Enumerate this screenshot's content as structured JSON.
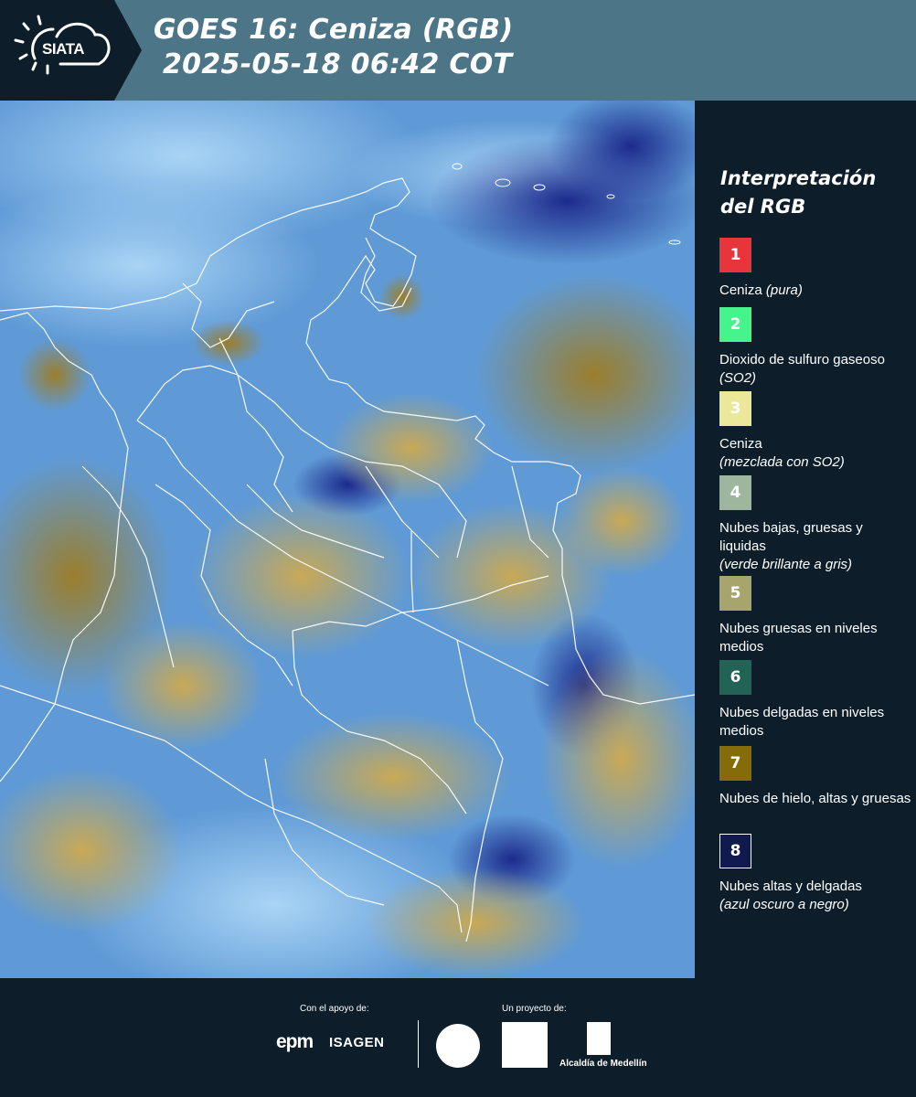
{
  "header": {
    "logo_text": "SIATA",
    "title_line1": "GOES 16: Ceniza (RGB)",
    "title_line2": "2025-05-18 06:42 COT"
  },
  "legend": {
    "title_line1": "Interpretación",
    "title_line2": "del RGB",
    "items": [
      {
        "num": "1",
        "color": "#e8353c",
        "label": "Ceniza",
        "label_italic": "(pura)"
      },
      {
        "num": "2",
        "color": "#45f58c",
        "label": "Dioxido de sulfuro gaseoso",
        "label_italic": "(SO2)"
      },
      {
        "num": "3",
        "color": "#ece89a",
        "label": "Ceniza",
        "label_italic": "(mezclada con SO2)"
      },
      {
        "num": "4",
        "color": "#9db69d",
        "label": "Nubes bajas, gruesas y liquidas",
        "label_italic": "(verde brillante a gris)"
      },
      {
        "num": "5",
        "color": "#a7a56c",
        "label": "Nubes gruesas en niveles medios",
        "label_italic": ""
      },
      {
        "num": "6",
        "color": "#216456",
        "label": "Nubes delgadas en niveles medios",
        "label_italic": ""
      },
      {
        "num": "7",
        "color": "#866b09",
        "label": "Nubes de hielo, altas y gruesas",
        "label_italic": ""
      },
      {
        "num": "8",
        "color": "#101a4e",
        "label": "Nubes altas y delgadas",
        "label_italic": "(azul oscuro a negro)"
      }
    ]
  },
  "footer": {
    "support_label": "Con el apoyo de:",
    "project_label": "Un proyecto de:",
    "epm": "epm",
    "isagen": "ISAGEN",
    "alcaldia": "Alcaldía de Medellín"
  }
}
